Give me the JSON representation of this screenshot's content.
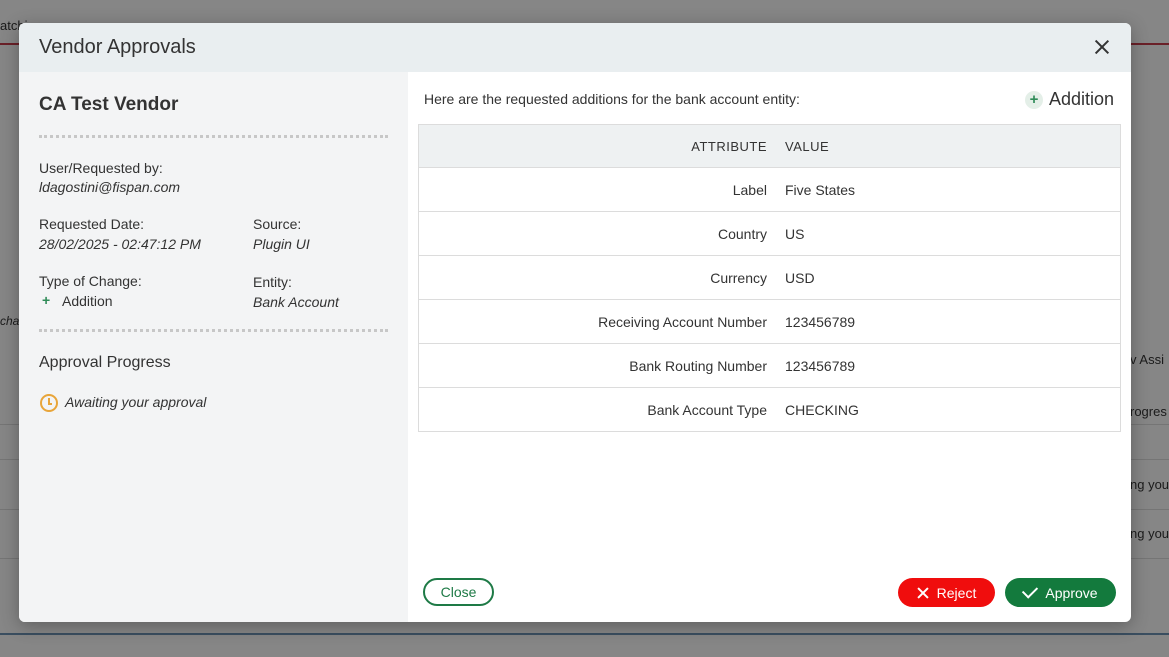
{
  "background": {
    "top_left_text": "atchi",
    "left_side_text": "cha",
    "right_texts": [
      "v Assi",
      "rogres",
      "ng you",
      "ng you"
    ]
  },
  "modal": {
    "title": "Vendor Approvals",
    "vendor_name": "CA Test Vendor",
    "fields": {
      "user_label": "User/Requested by:",
      "user_value": "ldagostini@fispan.com",
      "date_label": "Requested Date:",
      "date_value": "28/02/2025 - 02:47:12 PM",
      "source_label": "Source:",
      "source_value": "Plugin UI",
      "type_label": "Type of Change:",
      "type_value": "Addition",
      "entity_label": "Entity:",
      "entity_value": "Bank Account"
    },
    "approval": {
      "title": "Approval Progress",
      "status": "Awaiting your approval"
    },
    "intro": "Here are the requested additions for the bank account entity:",
    "change_badge": "Addition",
    "table": {
      "headers": [
        "ATTRIBUTE",
        "VALUE"
      ],
      "rows": [
        {
          "attribute": "Label",
          "value": "Five States"
        },
        {
          "attribute": "Country",
          "value": "US"
        },
        {
          "attribute": "Currency",
          "value": "USD"
        },
        {
          "attribute": "Receiving Account Number",
          "value": "123456789"
        },
        {
          "attribute": "Bank Routing Number",
          "value": "123456789"
        },
        {
          "attribute": "Bank Account Type",
          "value": "CHECKING"
        }
      ]
    },
    "buttons": {
      "close": "Close",
      "reject": "Reject",
      "approve": "Approve"
    }
  },
  "colors": {
    "approve": "#137a3d",
    "reject": "#f00d0d",
    "pending": "#e8a53a"
  }
}
